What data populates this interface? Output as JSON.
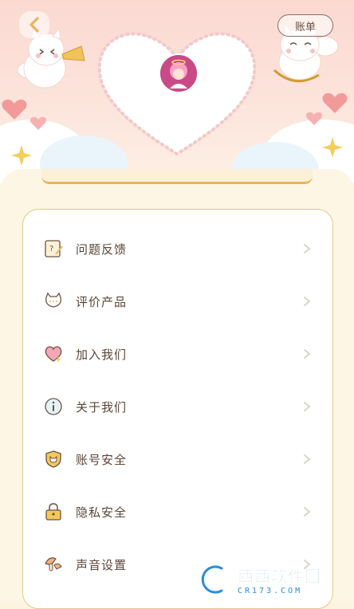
{
  "header": {
    "bill_label": "账单"
  },
  "menu": {
    "items": [
      {
        "label": "问题反馈",
        "icon": "feedback-note-icon"
      },
      {
        "label": "评价产品",
        "icon": "rate-cat-bubble-icon"
      },
      {
        "label": "加入我们",
        "icon": "join-heart-icon"
      },
      {
        "label": "关于我们",
        "icon": "about-info-icon"
      },
      {
        "label": "账号安全",
        "icon": "account-shield-icon"
      },
      {
        "label": "隐私安全",
        "icon": "privacy-lock-icon"
      },
      {
        "label": "声音设置",
        "icon": "sound-mushroom-icon"
      }
    ]
  },
  "watermark": {
    "brand": "西西软件园",
    "domain": "CR173.COM"
  },
  "colors": {
    "accent": "#e6b45a",
    "text": "#5a4638",
    "header_pink": "#fbd9d2",
    "background": "#fef6e4"
  }
}
